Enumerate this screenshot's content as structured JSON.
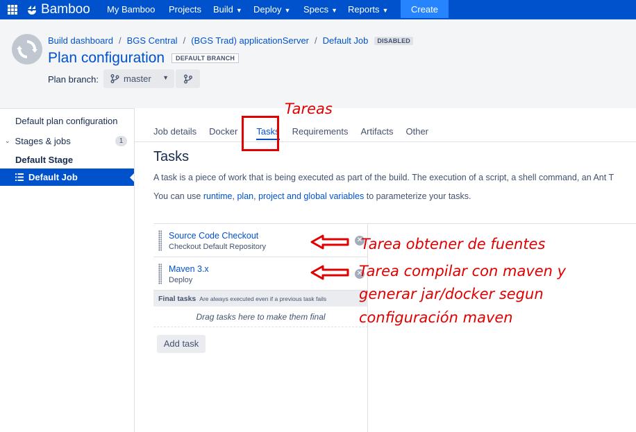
{
  "topnav": {
    "app_name": "Bamboo",
    "items": [
      {
        "label": "My Bamboo",
        "has_dropdown": false
      },
      {
        "label": "Projects",
        "has_dropdown": false
      },
      {
        "label": "Build",
        "has_dropdown": true
      },
      {
        "label": "Deploy",
        "has_dropdown": true
      },
      {
        "label": "Specs",
        "has_dropdown": true
      },
      {
        "label": "Reports",
        "has_dropdown": true
      }
    ],
    "create_label": "Create",
    "accent_color": "#0052cc"
  },
  "header": {
    "breadcrumb": [
      "Build dashboard",
      "BGS Central",
      "(BGS Trad) applicationServer",
      "Default Job"
    ],
    "breadcrumb_separator": "/",
    "status_lozenge": "DISABLED",
    "title": "Plan configuration",
    "branch_lozenge": "DEFAULT BRANCH",
    "branch_label": "Plan branch:",
    "branch_value": "master"
  },
  "sidebar": {
    "items": [
      {
        "label": "Default plan configuration"
      },
      {
        "label": "Stages & jobs",
        "count": "1"
      },
      {
        "label": "Default Stage"
      },
      {
        "label": "Default Job"
      }
    ]
  },
  "main": {
    "tabs": [
      {
        "label": "Job details"
      },
      {
        "label": "Docker"
      },
      {
        "label": "Tasks",
        "active": true
      },
      {
        "label": "Requirements"
      },
      {
        "label": "Artifacts"
      },
      {
        "label": "Other"
      }
    ],
    "heading": "Tasks",
    "description_1": "A task is a piece of work that is being executed as part of the build. The execution of a script, a shell command, an Ant T",
    "description_2": {
      "prefix": "You can use ",
      "link_1": "runtime",
      "sep_1": ", ",
      "link_2": "plan",
      "sep_2": ", ",
      "link_3": "project and global variables",
      "suffix": " to parameterize your tasks."
    },
    "tasks": [
      {
        "name": "Source Code Checkout",
        "description": "Checkout Default Repository"
      },
      {
        "name": "Maven 3.x",
        "description": "Deploy"
      }
    ],
    "final_tasks_title": "Final tasks",
    "final_tasks_note": "Are always executed even if a previous task fails",
    "final_tasks_drop": "Drag tasks here to make them final",
    "add_task_label": "Add task"
  },
  "annotations": {
    "tab_note": "Tareas",
    "task1_note": "Tarea obtener de fuentes",
    "task2_note_lines": [
      "Tarea compilar con maven y",
      "generar jar/docker segun",
      "configuración maven"
    ],
    "color": "#e00000"
  }
}
